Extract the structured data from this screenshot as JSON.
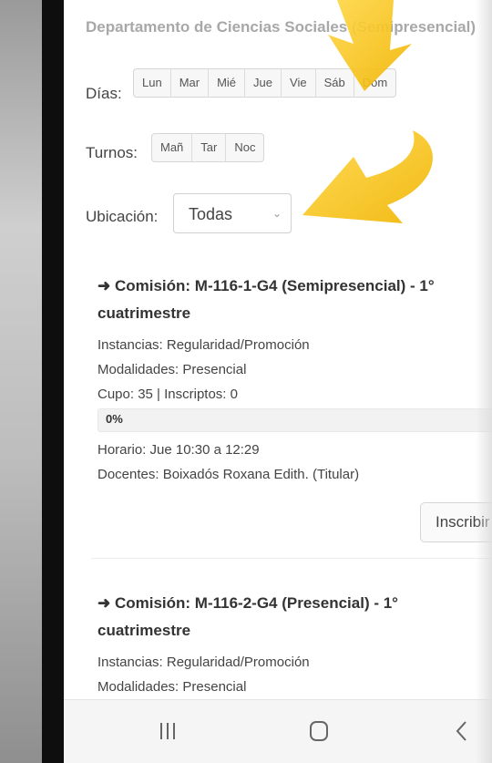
{
  "header": {
    "department": "Departamento de Ciencias Sociales (Semipresencial)"
  },
  "filters": {
    "days_label": "Días:",
    "days": [
      "Lun",
      "Mar",
      "Mié",
      "Jue",
      "Vie",
      "Sáb",
      "Dom"
    ],
    "shifts_label": "Turnos:",
    "shifts": [
      "Mañ",
      "Tar",
      "Noc"
    ],
    "location_label": "Ubicación:",
    "location_value": "Todas"
  },
  "commissions": [
    {
      "title": "Comisión: M-116-1-G4 (Semipresencial) - 1° cuatrimestre",
      "instancias": "Instancias: Regularidad/Promoción",
      "modalidades": "Modalidades: Presencial",
      "cupo": "Cupo: 35 | Inscriptos: 0",
      "progress_label": "0%",
      "progress_fraction": 0,
      "horario": "Horario: Jue 10:30 a 12:29",
      "docentes": "Docentes: Boixadós Roxana Edith. (Titular)",
      "action_label": "Inscribir"
    },
    {
      "title": "Comisión: M-116-2-G4 (Presencial) - 1° cuatrimestre",
      "instancias": "Instancias: Regularidad/Promoción",
      "modalidades": "Modalidades: Presencial"
    }
  ],
  "system_nav": {
    "recents_icon": "recents-icon",
    "home_icon": "home-icon",
    "back_icon": "back-icon"
  },
  "colors": {
    "annotation_arrow": "#f5c518",
    "progress_fill": "#2b8fd6"
  }
}
